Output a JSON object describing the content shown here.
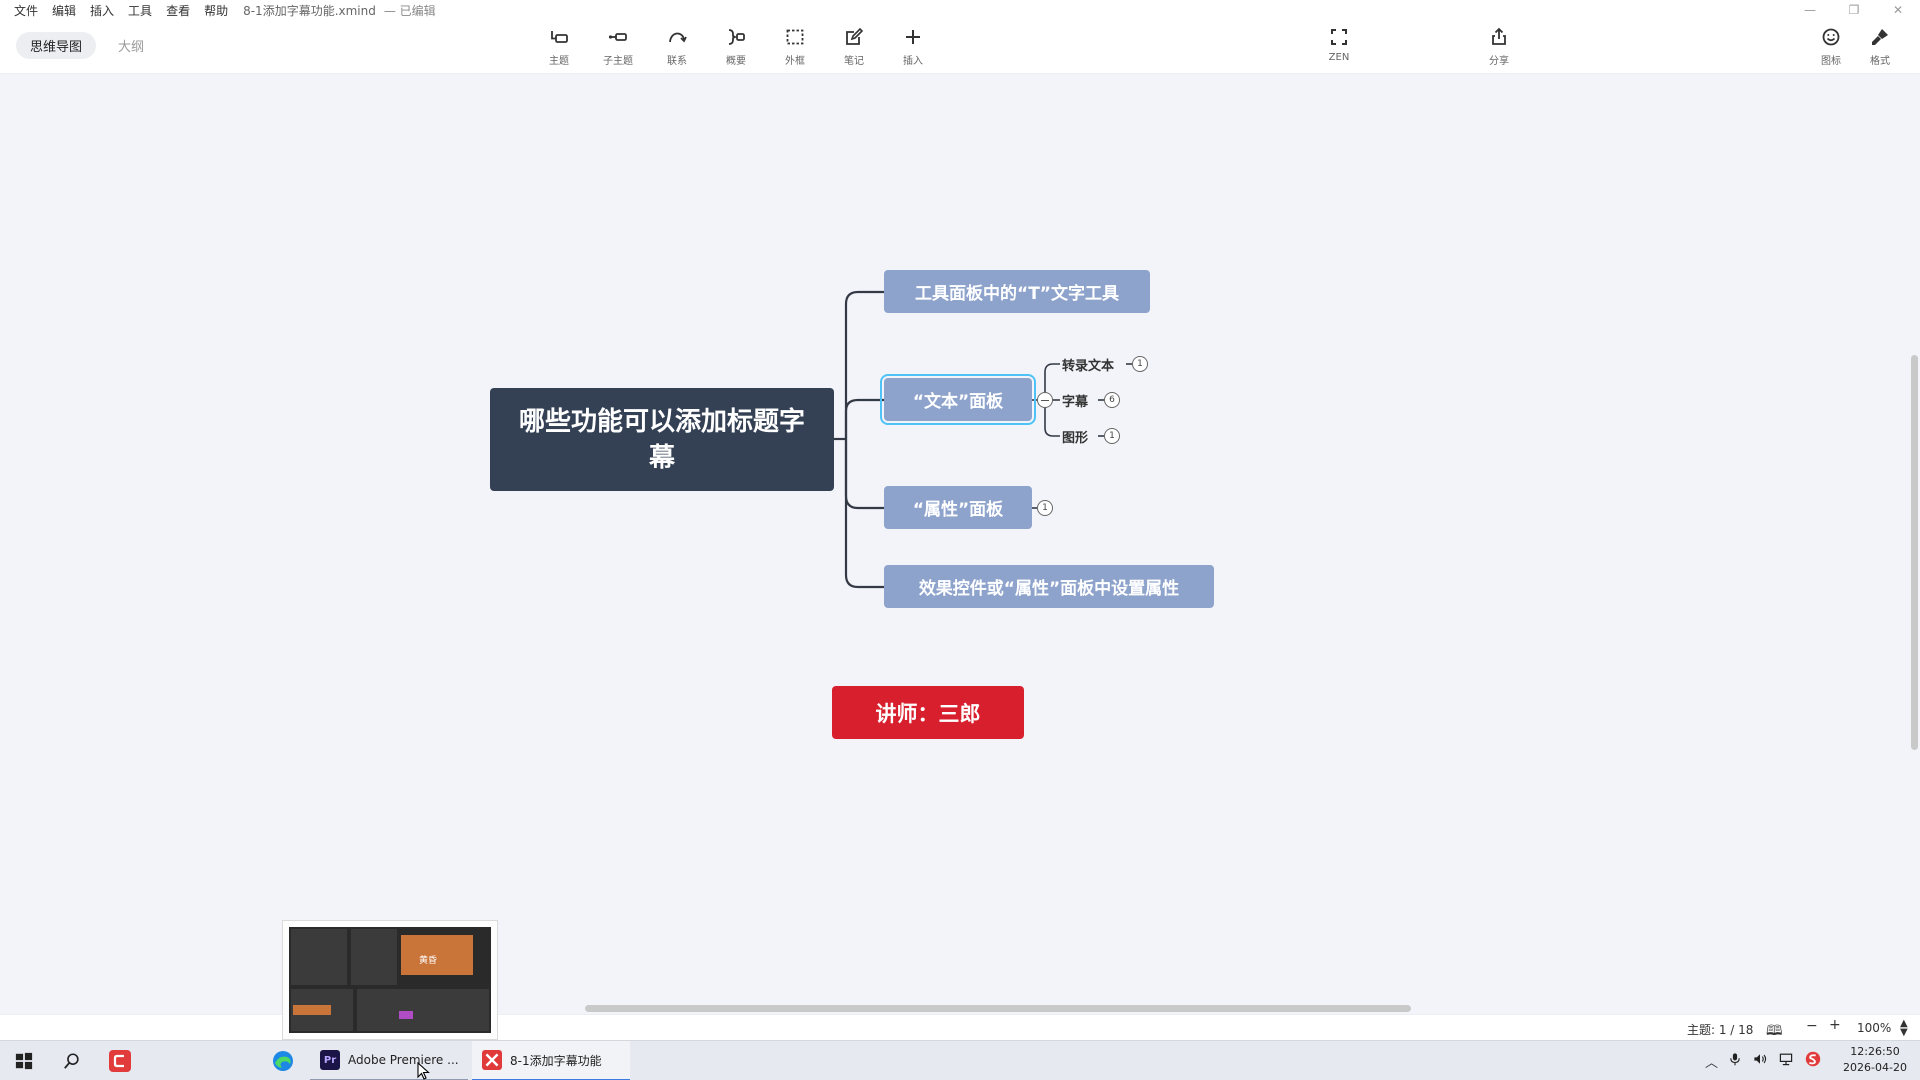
{
  "menu": {
    "items": [
      "文件",
      "编辑",
      "插入",
      "工具",
      "查看",
      "帮助"
    ],
    "document_title": "8-1添加字幕功能.xmind",
    "document_status": "— 已编辑"
  },
  "window_controls": [
    "—",
    "❐",
    "✕"
  ],
  "view_tabs": {
    "mindmap": "思维导图",
    "outline": "大纲"
  },
  "toolbar": {
    "topic": "主题",
    "subtopic": "子主题",
    "relationship": "联系",
    "summary": "概要",
    "boundary": "外框",
    "note": "笔记",
    "insert": "插入",
    "zen": "ZEN",
    "share": "分享",
    "icon": "图标",
    "format": "格式"
  },
  "mindmap": {
    "central_topic": "哪些功能可以添加标题字幕",
    "topics": [
      {
        "label": "工具面板中的“T”文字工具"
      },
      {
        "label": "“文本”面板",
        "subtopics": [
          {
            "label": "转录文本",
            "count": "1"
          },
          {
            "label": "字幕",
            "count": "6"
          },
          {
            "label": "图形",
            "count": "1"
          }
        ]
      },
      {
        "label": "“属性”面板",
        "count": "1"
      },
      {
        "label": "效果控件或“属性”面板中设置属性"
      }
    ],
    "floating_topic": "讲师：三郎"
  },
  "statusbar": {
    "topic_count": "主题: 1 / 18",
    "zoom": "100%",
    "zoom_out": "−",
    "zoom_in": "+"
  },
  "taskbar": {
    "preview_label": "黄昏",
    "premiere_label": "Adobe Premiere ...",
    "premiere_icon": "Pr",
    "xmind_label": "8-1添加字幕功能",
    "time": "12:26:50",
    "date": "2026-04-20"
  },
  "colors": {
    "central": "#344154",
    "topic": "#8ea3cc",
    "floating": "#d81f2d",
    "selection": "#4fc3f7"
  }
}
